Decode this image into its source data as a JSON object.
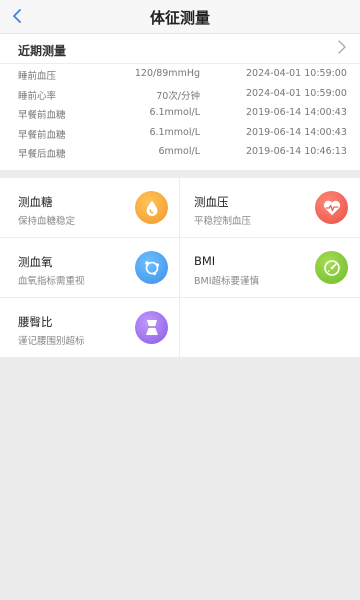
{
  "header": {
    "title": "体征测量"
  },
  "recent": {
    "title": "近期测量",
    "rows": [
      {
        "name": "睡前血压",
        "value": "120/89mmHg",
        "time": "2024-04-01 10:59:00"
      },
      {
        "name": "睡前心率",
        "value": "70次/分钟",
        "time": "2024-04-01 10:59:00"
      },
      {
        "name": "早餐前血糖",
        "value": "6.1mmol/L",
        "time": "2019-06-14 14:00:43"
      },
      {
        "name": "早餐前血糖",
        "value": "6.1mmol/L",
        "time": "2019-06-14 14:00:43"
      },
      {
        "name": "早餐后血糖",
        "value": "6mmol/L",
        "time": "2019-06-14 10:46:13"
      }
    ]
  },
  "cards": {
    "blood_sugar": {
      "title": "测血糖",
      "subtitle": "保持血糖稳定",
      "icon": "blood-drop-icon",
      "color": "#f5a033"
    },
    "blood_pressure": {
      "title": "测血压",
      "subtitle": "平稳控制血压",
      "icon": "heart-pulse-icon",
      "color": "#ee5a4e"
    },
    "blood_oxygen": {
      "title": "测血氧",
      "subtitle": "血氧指标需重视",
      "icon": "oxygen-molecule-icon",
      "color": "#3d9bec"
    },
    "bmi": {
      "title": "BMI",
      "subtitle": "BMI超标要谨慎",
      "icon": "scale-gauge-icon",
      "color": "#7cc436"
    },
    "waist_hip": {
      "title": "腰臀比",
      "subtitle": "谨记腰围别超标",
      "icon": "waist-body-icon",
      "color": "#9a68e8"
    }
  }
}
